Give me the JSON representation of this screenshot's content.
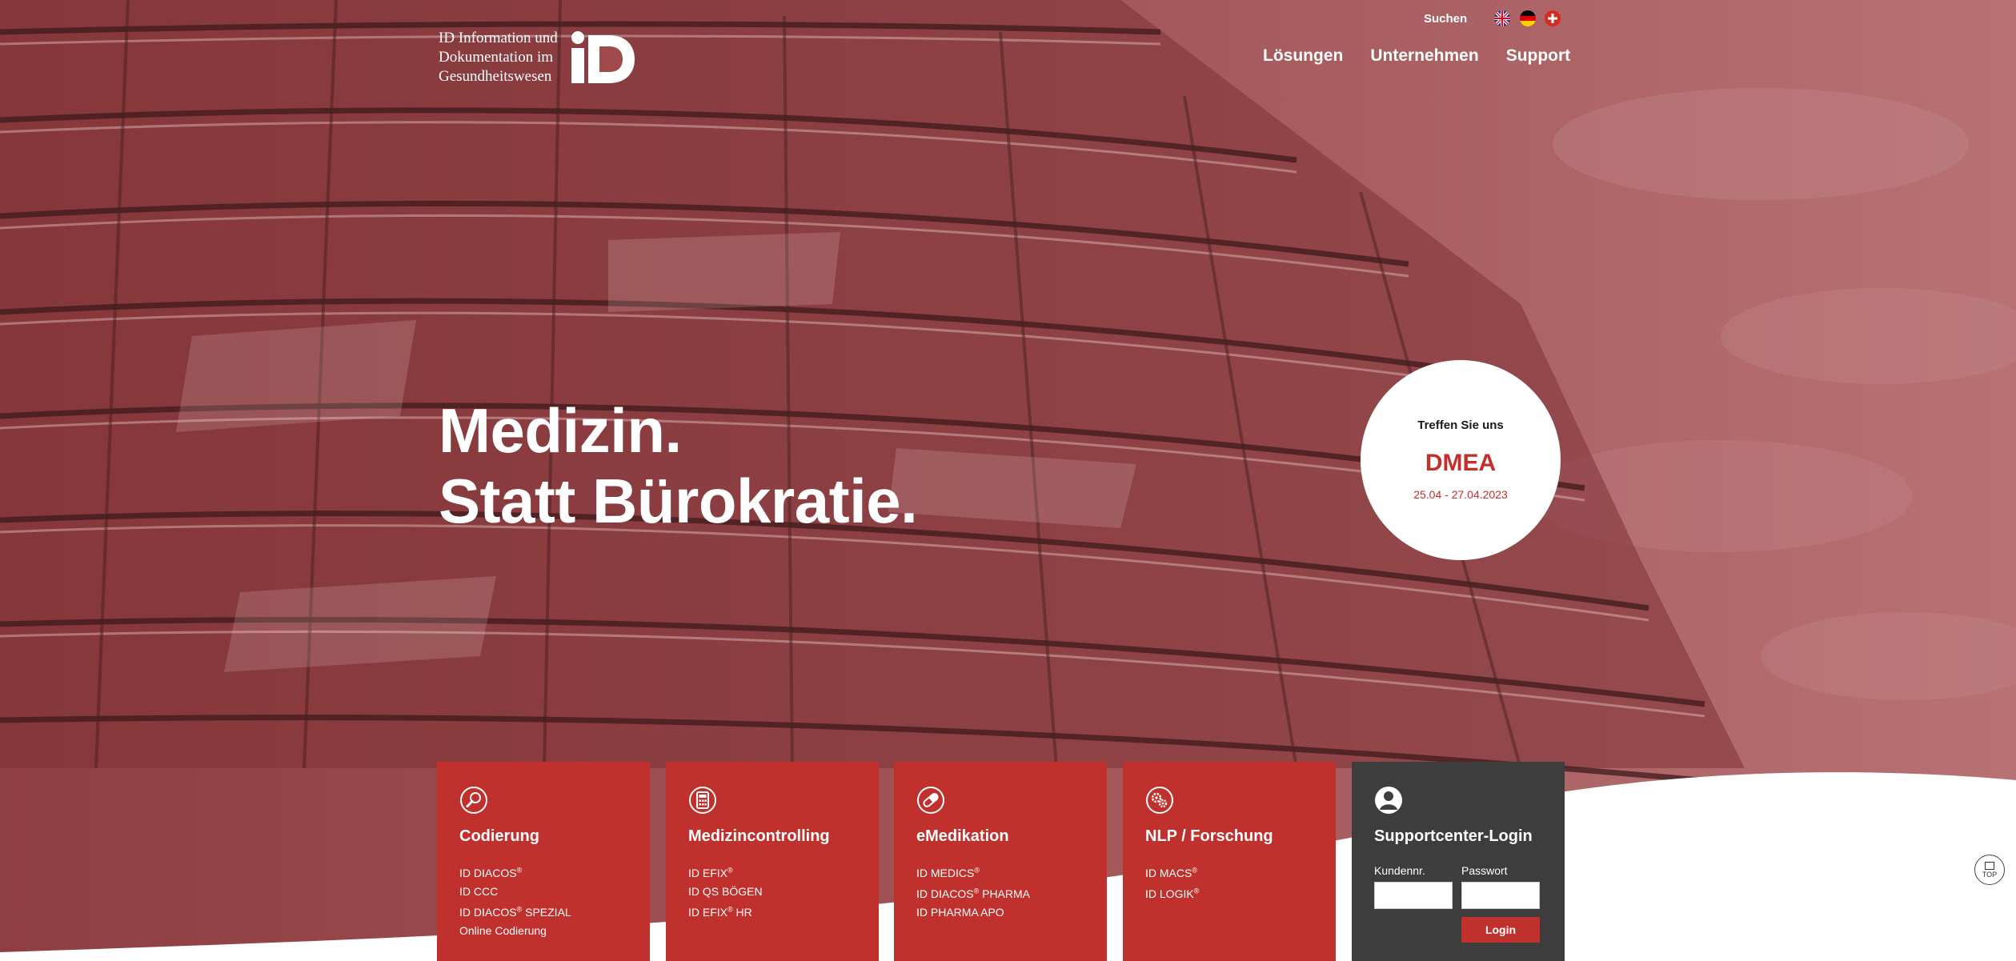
{
  "header": {
    "logo_lines": [
      "ID Information und",
      "Dokumentation im",
      "Gesundheitswesen"
    ],
    "logo_mark": "iD",
    "search_label": "Suchen",
    "languages": [
      {
        "code": "en",
        "icon": "flag-uk-icon"
      },
      {
        "code": "de",
        "icon": "flag-germany-icon"
      },
      {
        "code": "ch",
        "icon": "flag-switzerland-icon"
      }
    ],
    "nav": [
      "Lösungen",
      "Unternehmen",
      "Support"
    ]
  },
  "hero": {
    "headline_line1": "Medizin.",
    "headline_line2": "Statt Bürokratie."
  },
  "event": {
    "pretitle": "Treffen Sie uns",
    "title": "DMEA",
    "date": "25.04 - 27.04.2023"
  },
  "tiles": [
    {
      "title": "Codierung",
      "icon": "magnifier-icon",
      "items": [
        {
          "name": "ID DIACOS",
          "reg": "®",
          "suffix": ""
        },
        {
          "name": "ID CCC",
          "reg": "",
          "suffix": ""
        },
        {
          "name": "ID DIACOS",
          "reg": "®",
          "suffix": " SPEZIAL"
        },
        {
          "name": "Online Codierung",
          "reg": "",
          "suffix": ""
        }
      ]
    },
    {
      "title": "Medizincontrolling",
      "icon": "calculator-icon",
      "items": [
        {
          "name": "ID EFIX",
          "reg": "®",
          "suffix": ""
        },
        {
          "name": "ID QS BÖGEN",
          "reg": "",
          "suffix": ""
        },
        {
          "name": "ID EFIX",
          "reg": "®",
          "suffix": " HR"
        }
      ]
    },
    {
      "title": "eMedikation",
      "icon": "pill-icon",
      "items": [
        {
          "name": "ID MEDICS",
          "reg": "®",
          "suffix": ""
        },
        {
          "name": "ID DIACOS",
          "reg": "®",
          "suffix": " PHARMA"
        },
        {
          "name": "ID PHARMA APO",
          "reg": "",
          "suffix": ""
        }
      ]
    },
    {
      "title": "NLP / Forschung",
      "icon": "gears-icon",
      "items": [
        {
          "name": "ID MACS",
          "reg": "®",
          "suffix": ""
        },
        {
          "name": "ID LOGIK",
          "reg": "®",
          "suffix": ""
        }
      ]
    }
  ],
  "login": {
    "title": "Supportcenter-Login",
    "icon": "user-icon",
    "customer_label": "Kundennr.",
    "customer_value": "",
    "password_label": "Passwort",
    "password_value": "",
    "button_label": "Login"
  },
  "top_button": {
    "label": "TOP",
    "icon": "top-arrow-icon"
  },
  "colors": {
    "brand_red": "#c0302d",
    "dark_tile": "#3d3d3d",
    "hero_tint": "#9a4a4c"
  }
}
